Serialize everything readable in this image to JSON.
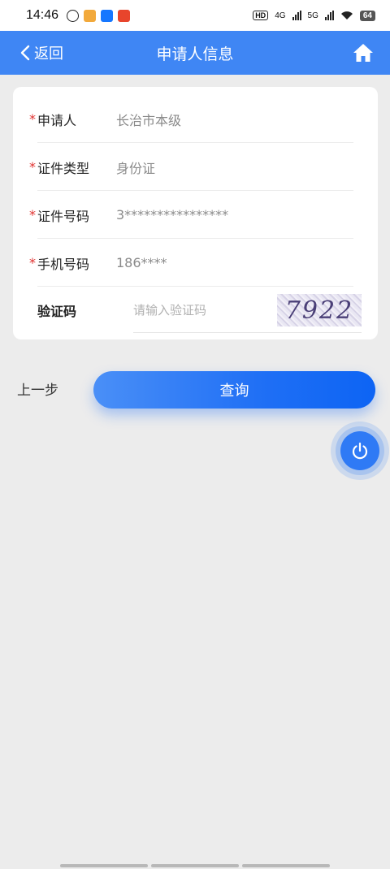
{
  "status": {
    "time": "14:46",
    "hd": "HD",
    "net1": "4G",
    "net2": "5G",
    "battery": "64"
  },
  "header": {
    "back_label": "返回",
    "title": "申请人信息",
    "home_icon": "home-icon"
  },
  "form": {
    "applicant": {
      "label": "申请人",
      "value": "长治市本级"
    },
    "id_type": {
      "label": "证件类型",
      "value": "身份证"
    },
    "id_number": {
      "label": "证件号码",
      "value": "3****************"
    },
    "phone": {
      "label": "手机号码",
      "value": "186****"
    },
    "captcha": {
      "label": "验证码",
      "placeholder": "请输入验证码",
      "code": "7922"
    }
  },
  "actions": {
    "prev_label": "上一步",
    "query_label": "查询"
  },
  "colors": {
    "accent": "#3f86f4",
    "required": "#e0322f"
  }
}
